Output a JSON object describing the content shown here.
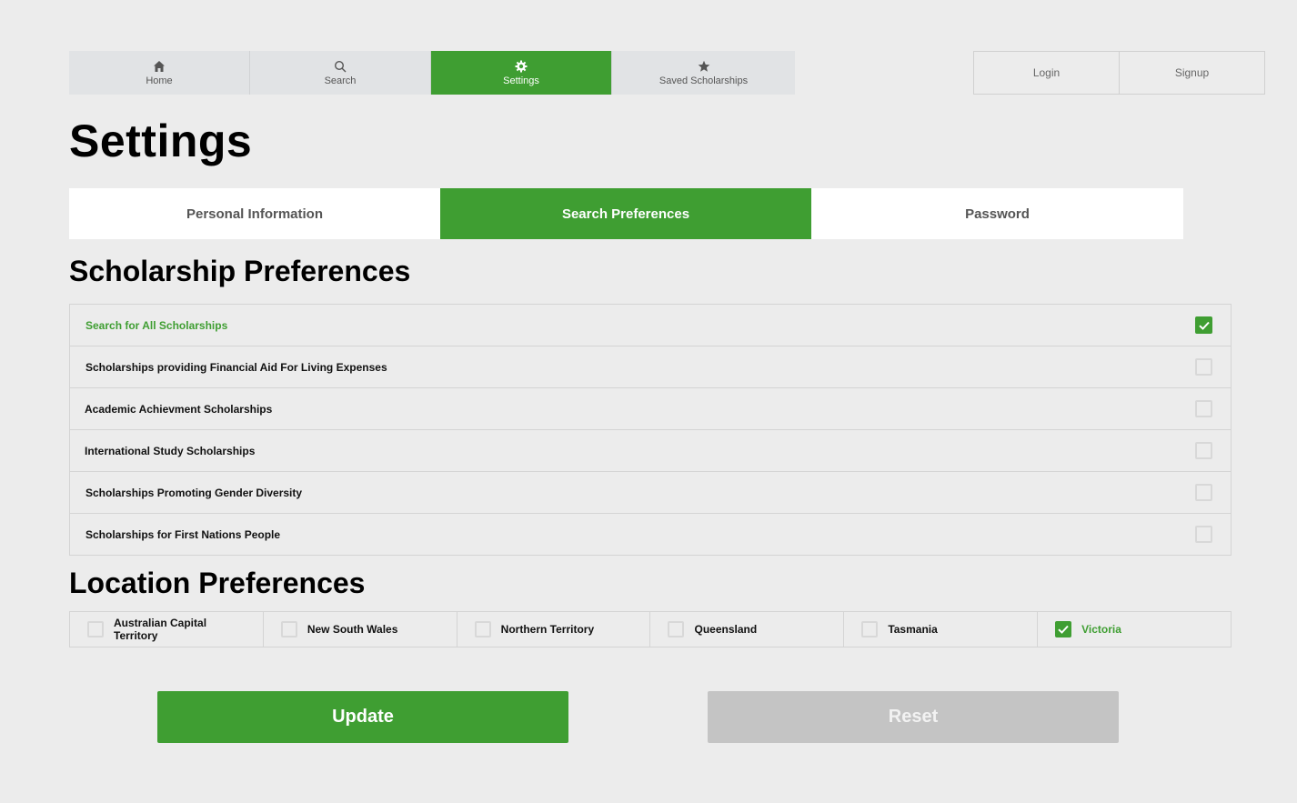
{
  "nav": {
    "items": [
      {
        "label": "Home",
        "icon": "home-icon"
      },
      {
        "label": "Search",
        "icon": "search-icon"
      },
      {
        "label": "Settings",
        "icon": "gear-icon",
        "active": true
      },
      {
        "label": "Saved Scholarships",
        "icon": "star-icon"
      }
    ]
  },
  "auth": {
    "login_label": "Login",
    "signup_label": "Signup"
  },
  "page": {
    "title": "Settings"
  },
  "tabs": [
    {
      "label": "Personal Information"
    },
    {
      "label": "Search Preferences",
      "active": true
    },
    {
      "label": "Password"
    }
  ],
  "scholarship_section": {
    "title": "Scholarship Preferences",
    "items": [
      {
        "label": "Search for All Scholarships",
        "checked": true
      },
      {
        "label": "Scholarships providing Financial Aid For Living Expenses",
        "checked": false
      },
      {
        "label": "Academic Achievment Scholarships",
        "checked": false
      },
      {
        "label": "International Study Scholarships",
        "checked": false
      },
      {
        "label": "Scholarships Promoting Gender Diversity",
        "checked": false
      },
      {
        "label": "Scholarships for First Nations People",
        "checked": false
      }
    ]
  },
  "location_section": {
    "title": "Location Preferences",
    "items": [
      {
        "label": "Australian Capital Territory",
        "checked": false
      },
      {
        "label": "New South Wales",
        "checked": false
      },
      {
        "label": "Northern Territory",
        "checked": false
      },
      {
        "label": "Queensland",
        "checked": false
      },
      {
        "label": "Tasmania",
        "checked": false
      },
      {
        "label": "Victoria",
        "checked": true
      }
    ]
  },
  "actions": {
    "update_label": "Update",
    "reset_label": "Reset"
  },
  "colors": {
    "accent": "#3f9e32",
    "disabled": "#c4c4c4",
    "background": "#ececec"
  }
}
